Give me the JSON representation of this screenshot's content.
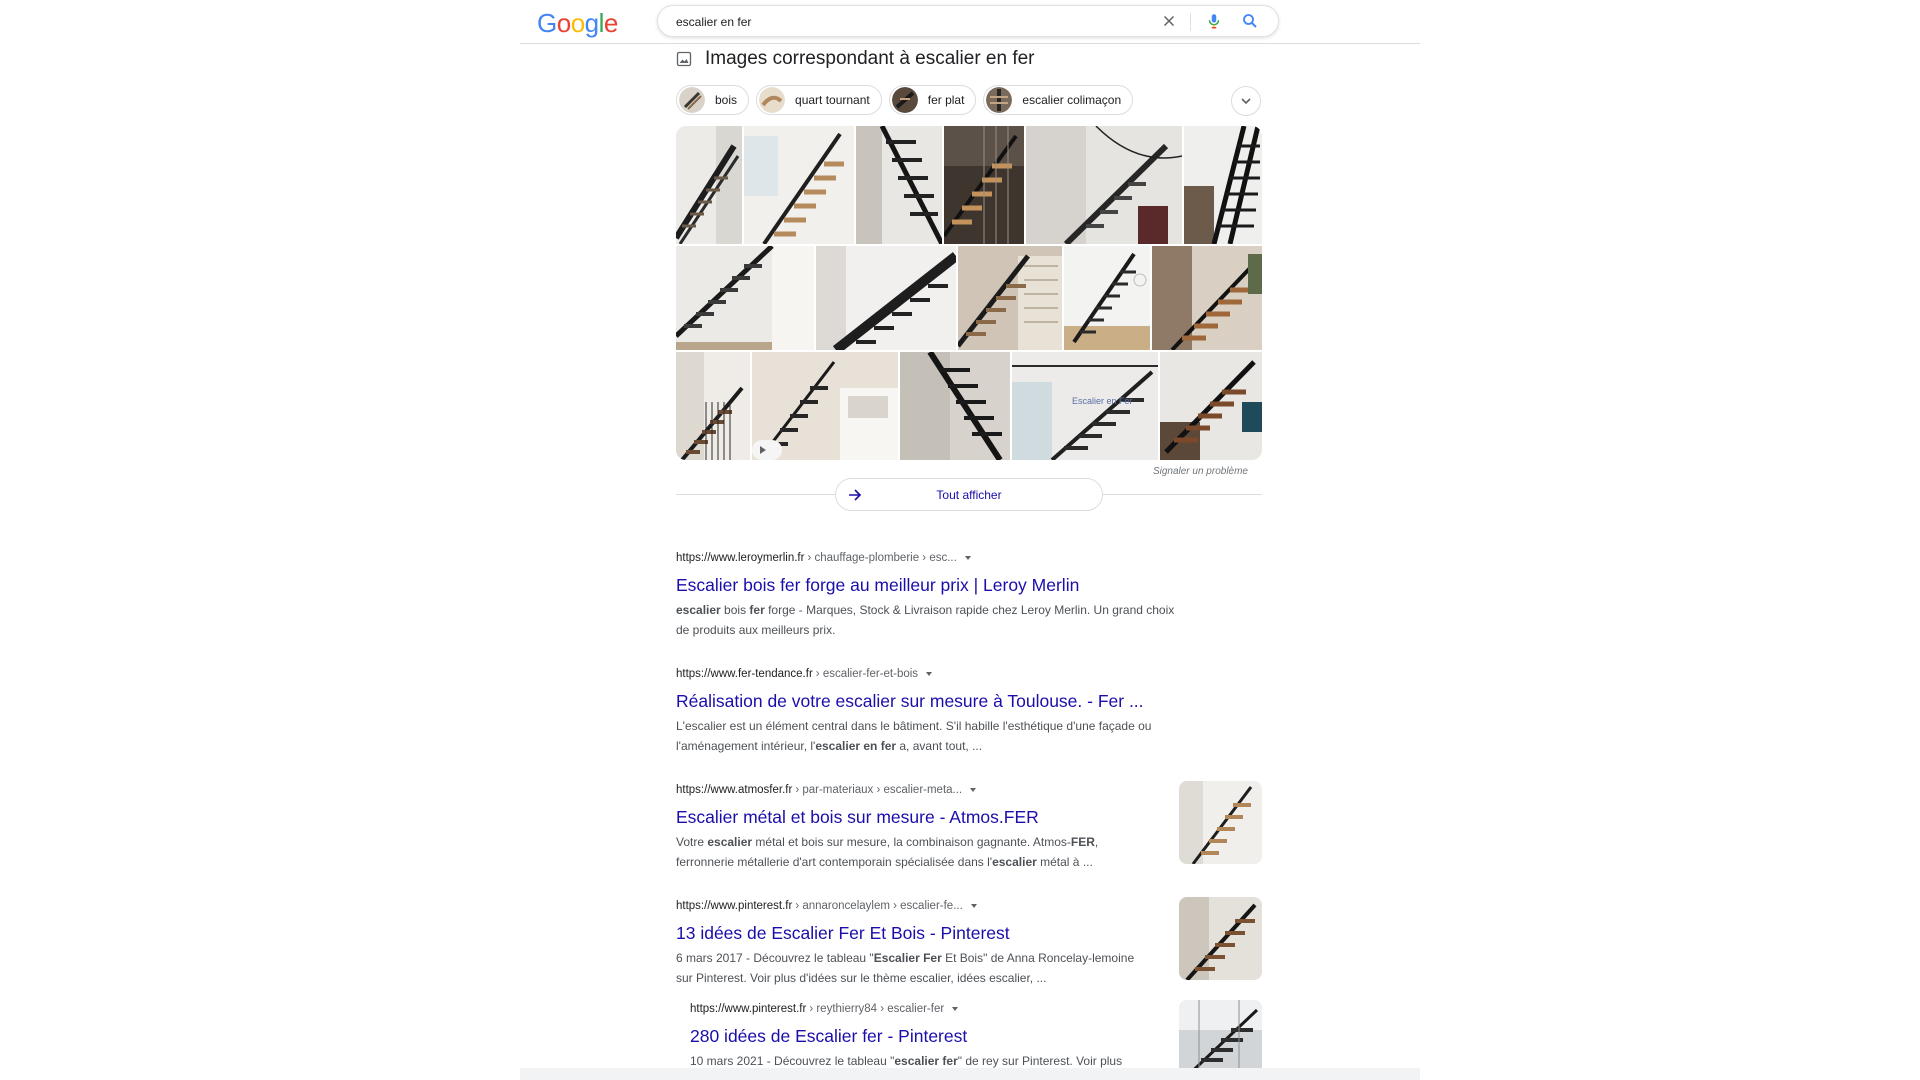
{
  "header": {
    "logo_letters": [
      "G",
      "o",
      "o",
      "g",
      "l",
      "e"
    ],
    "logo_colors": [
      "#4285F4",
      "#EA4335",
      "#FBBC05",
      "#4285F4",
      "#34A853",
      "#EA4335"
    ],
    "query": "escalier en fer",
    "clear_icon": "close-icon",
    "mic_icon": "mic-icon",
    "search_icon": "search-icon"
  },
  "images": {
    "heading": "Images correspondant à escalier en fer",
    "heading_icon": "image-icon",
    "chips": [
      {
        "label": "bois"
      },
      {
        "label": "quart tournant"
      },
      {
        "label": "fer plat"
      },
      {
        "label": "escalier colimaçon"
      }
    ],
    "chips_more_icon": "chevron-down-icon",
    "report_label": "Signaler un problème",
    "show_all_label": "Tout afficher",
    "show_all_icon": "arrow-right-icon"
  },
  "results": [
    {
      "domain": "https://www.leroymerlin.fr",
      "path": "› chauffage-plomberie › esc...",
      "title": "Escalier bois fer forge au meilleur prix | Leroy Merlin",
      "snippet_html": "<b>escalier</b> bois <b>fer</b> forge - Marques, Stock &amp; Livraison rapide chez Leroy Merlin. Un grand choix<br>de produits aux meilleurs prix."
    },
    {
      "domain": "https://www.fer-tendance.fr",
      "path": "› escalier-fer-et-bois",
      "title": "Réalisation de votre escalier sur mesure à Toulouse. - Fer ...",
      "snippet_html": "L'escalier est un élément central dans le bâtiment. S'il habille l'esthétique d'une façade ou<br>l'aménagement intérieur, l'<b>escalier en fer</b> a, avant tout, ..."
    },
    {
      "domain": "https://www.atmosfer.fr",
      "path": "› par-materiaux › escalier-meta...",
      "title": "Escalier métal et bois sur mesure - Atmos.FER",
      "snippet_html": "Votre <b>escalier</b> métal et bois sur mesure, la combinaison gagnante. Atmos-<b>FER</b>,<br>ferronnerie métallerie d'art contemporain spécialisée dans l'<b>escalier</b> métal à ..."
    },
    {
      "domain": "https://www.pinterest.fr",
      "path": "› annaroncelaylem › escalier-fe...",
      "title": "13 idées de Escalier Fer Et Bois - Pinterest",
      "snippet_html": "6 mars 2017 - Découvrez le tableau \"<b>Escalier Fer</b> Et Bois\" de Anna Roncelay-lemoine<br>sur Pinterest. Voir plus d'idées sur le thème escalier, idées escalier, ..."
    },
    {
      "domain": "https://www.pinterest.fr",
      "path": "› reythierry84 › escalier-fer",
      "title": "280 idées de Escalier fer - Pinterest",
      "snippet_html": "10 mars 2021 - Découvrez le tableau \"<b>escalier fer</b>\" de rey sur Pinterest. Voir plus<br>d'idées sur le thème escalier, <b>escalier fer</b>, idées escalier."
    }
  ]
}
